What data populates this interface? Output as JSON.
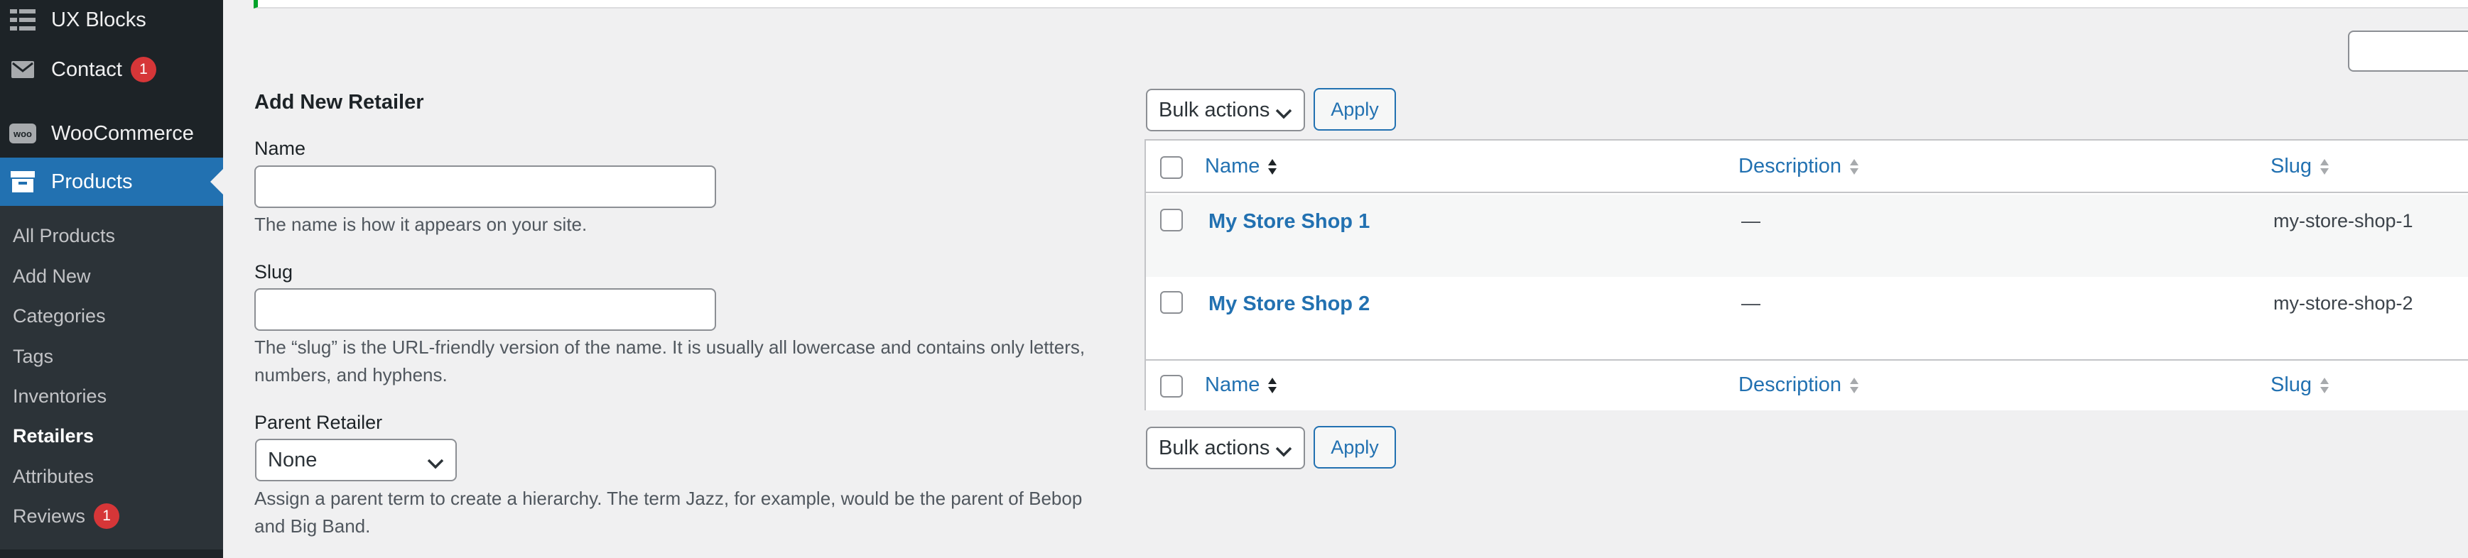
{
  "sidebar": {
    "items": [
      {
        "label": "UX Blocks",
        "icon": "grid-icon"
      },
      {
        "label": "Contact",
        "icon": "mail-icon",
        "badge": "1"
      },
      {
        "label": "WooCommerce",
        "icon": "woo-icon"
      },
      {
        "label": "Products",
        "icon": "archive-icon"
      }
    ],
    "submenu": [
      {
        "label": "All Products"
      },
      {
        "label": "Add New"
      },
      {
        "label": "Categories"
      },
      {
        "label": "Tags"
      },
      {
        "label": "Inventories"
      },
      {
        "label": "Retailers"
      },
      {
        "label": "Attributes"
      },
      {
        "label": "Reviews",
        "badge": "1"
      }
    ]
  },
  "form": {
    "title": "Add New Retailer",
    "name_label": "Name",
    "name_value": "",
    "name_help": "The name is how it appears on your site.",
    "slug_label": "Slug",
    "slug_value": "",
    "slug_help": "The “slug” is the URL-friendly version of the name. It is usually all lowercase and contains only letters, numbers, and hyphens.",
    "parent_label": "Parent Retailer",
    "parent_value": "None",
    "parent_help": "Assign a parent term to create a hierarchy. The term Jazz, for example, would be the parent of Bebop and Big Band."
  },
  "table": {
    "bulk_actions_label": "Bulk actions",
    "apply_label": "Apply",
    "columns": {
      "name": "Name",
      "description": "Description",
      "slug": "Slug"
    },
    "rows": [
      {
        "name": "My Store Shop 1",
        "description": "—",
        "slug": "my-store-shop-1"
      },
      {
        "name": "My Store Shop 2",
        "description": "—",
        "slug": "my-store-shop-2"
      }
    ]
  },
  "colors": {
    "sidebar_bg": "#1d2327",
    "submenu_bg": "#2c3338",
    "accent": "#2271b1",
    "badge": "#d63638",
    "notice_border": "#00a32a"
  }
}
